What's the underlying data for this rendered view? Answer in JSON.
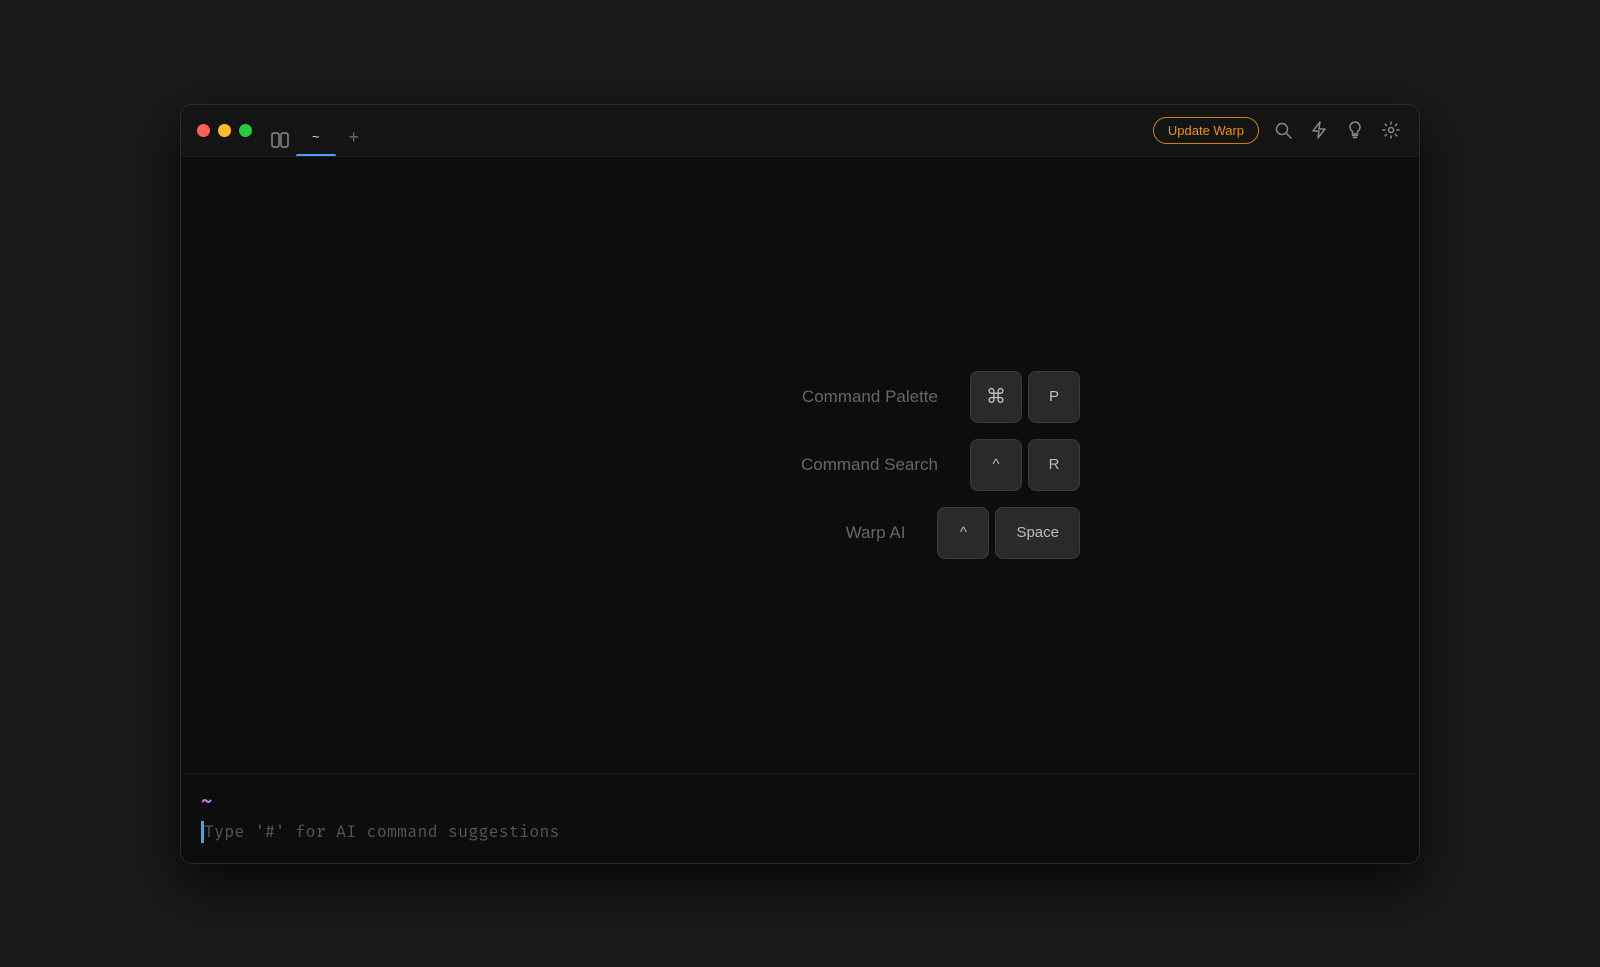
{
  "window": {
    "title": "~"
  },
  "titlebar": {
    "tab_label": "~",
    "new_tab_label": "+",
    "update_button_label": "Update Warp",
    "update_button_color": "#e8960c",
    "update_button_border": "#c8840a"
  },
  "icons": {
    "search": "⌕",
    "lightning": "⚡",
    "bulb": "💡",
    "gear": "⚙"
  },
  "shortcuts": [
    {
      "label": "Command Palette",
      "keys": [
        "⌘",
        "P"
      ]
    },
    {
      "label": "Command Search",
      "keys": [
        "^",
        "R"
      ]
    },
    {
      "label": "Warp AI",
      "keys": [
        "^",
        "Space"
      ]
    }
  ],
  "input": {
    "prompt_symbol": "~",
    "placeholder": "Type '#' for AI command suggestions"
  }
}
